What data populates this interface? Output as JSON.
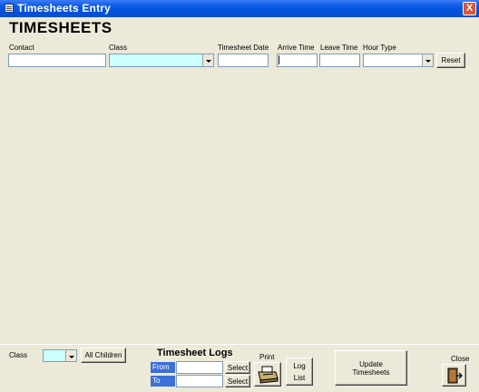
{
  "window": {
    "title": "Timesheets Entry",
    "close_label": "X"
  },
  "heading": "TIMESHEETS",
  "entry": {
    "contact_label": "Contact",
    "class_label": "Class",
    "date_label": "Timesheet Date",
    "arrive_label": "Arrive Time",
    "leave_label": "Leave Time",
    "hourtype_label": "Hour Type",
    "reset_label": "Reset",
    "contact_value": "",
    "class_value": "",
    "date_value": "",
    "arrive_value": "",
    "leave_value": "",
    "hourtype_value": ""
  },
  "footer": {
    "class_label": "Class",
    "class_value": "",
    "all_children_label": "All Children",
    "logs_title": "Timesheet Logs",
    "from_label": "From",
    "to_label": "To",
    "from_value": "",
    "to_value": "",
    "select_label": "Select",
    "print_label": "Print",
    "log_label": "Log",
    "list_label": "List",
    "update_label": "Update Timesheets",
    "close_label": "Close"
  },
  "colors": {
    "titlebar": "#0a5ce6",
    "form_bg": "#ece9d8",
    "class_combo_bg": "#ccffff",
    "from_to_label_bg": "#3d6fd8"
  },
  "icons": {
    "printer": "printer-icon",
    "exit": "exit-door-icon",
    "app": "form-icon"
  }
}
